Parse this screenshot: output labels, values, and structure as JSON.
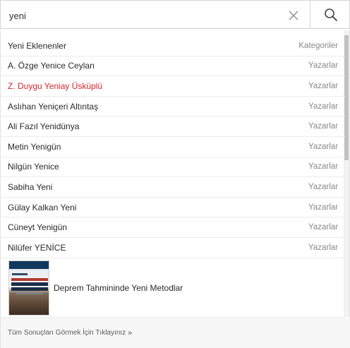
{
  "search": {
    "query": "yeni"
  },
  "icons": {
    "clear": "close-icon",
    "search": "magnifier-icon"
  },
  "colors": {
    "highlight": "#d7262b"
  },
  "header_row": {
    "label": "Yeni Eklenenler",
    "type": "Kategoriler"
  },
  "results": [
    {
      "name": "A. Özge Yenice Ceylan",
      "type": "Yazarlar"
    },
    {
      "name": "Z. Duygu Yeniay Üsküplü",
      "type": "Yazarlar"
    },
    {
      "name": "Aslıhan Yeniçeri Altıntaş",
      "type": "Yazarlar"
    },
    {
      "name": "Ali Fazıl Yenidünya",
      "type": "Yazarlar"
    },
    {
      "name": "Metin Yenigün",
      "type": "Yazarlar"
    },
    {
      "name": "Nilgün Yenice",
      "type": "Yazarlar"
    },
    {
      "name": "Sabiha Yeni",
      "type": "Yazarlar"
    },
    {
      "name": "Gülay Kalkan Yeni",
      "type": "Yazarlar"
    },
    {
      "name": "Cüneyt Yenigün",
      "type": "Yazarlar"
    },
    {
      "name": "Nilüfer YENİCE",
      "type": "Yazarlar"
    }
  ],
  "product": {
    "title": "Deprem Tahmininde Yeni Metodlar"
  },
  "footer": {
    "label": "Tüm Sonuçları Görmek İçin Tıklayınız",
    "chevron": "»"
  }
}
